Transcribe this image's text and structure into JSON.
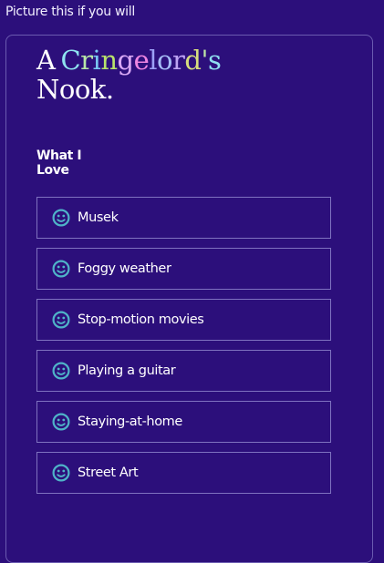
{
  "header": {
    "caption": "Picture this if you will"
  },
  "title": {
    "prefix": "A",
    "name_letters": [
      {
        "char": "C",
        "color": "#8fe3f0"
      },
      {
        "char": "r",
        "color": "#b8e6a7"
      },
      {
        "char": "i",
        "color": "#7ac8f2"
      },
      {
        "char": "n",
        "color": "#b9e36b"
      },
      {
        "char": "g",
        "color": "#d9a9f6"
      },
      {
        "char": "e",
        "color": "#ee86e2"
      },
      {
        "char": "l",
        "color": "#9ca0f6"
      },
      {
        "char": "o",
        "color": "#a6bdf7"
      },
      {
        "char": "r",
        "color": "#bda3f3"
      },
      {
        "char": "d",
        "color": "#d7dd7e"
      },
      {
        "char": "'",
        "color": "#bde5a6"
      },
      {
        "char": "s",
        "color": "#8fdff0"
      }
    ],
    "second_line": "Nook."
  },
  "section": {
    "heading": "What I Love"
  },
  "loves": {
    "icon": "smiley-icon",
    "icon_color": "#4fb3c8",
    "items": [
      "Musek",
      "Foggy weather",
      "Stop-motion movies",
      "Playing a guitar",
      "Staying-at-home",
      "Street Art"
    ]
  }
}
